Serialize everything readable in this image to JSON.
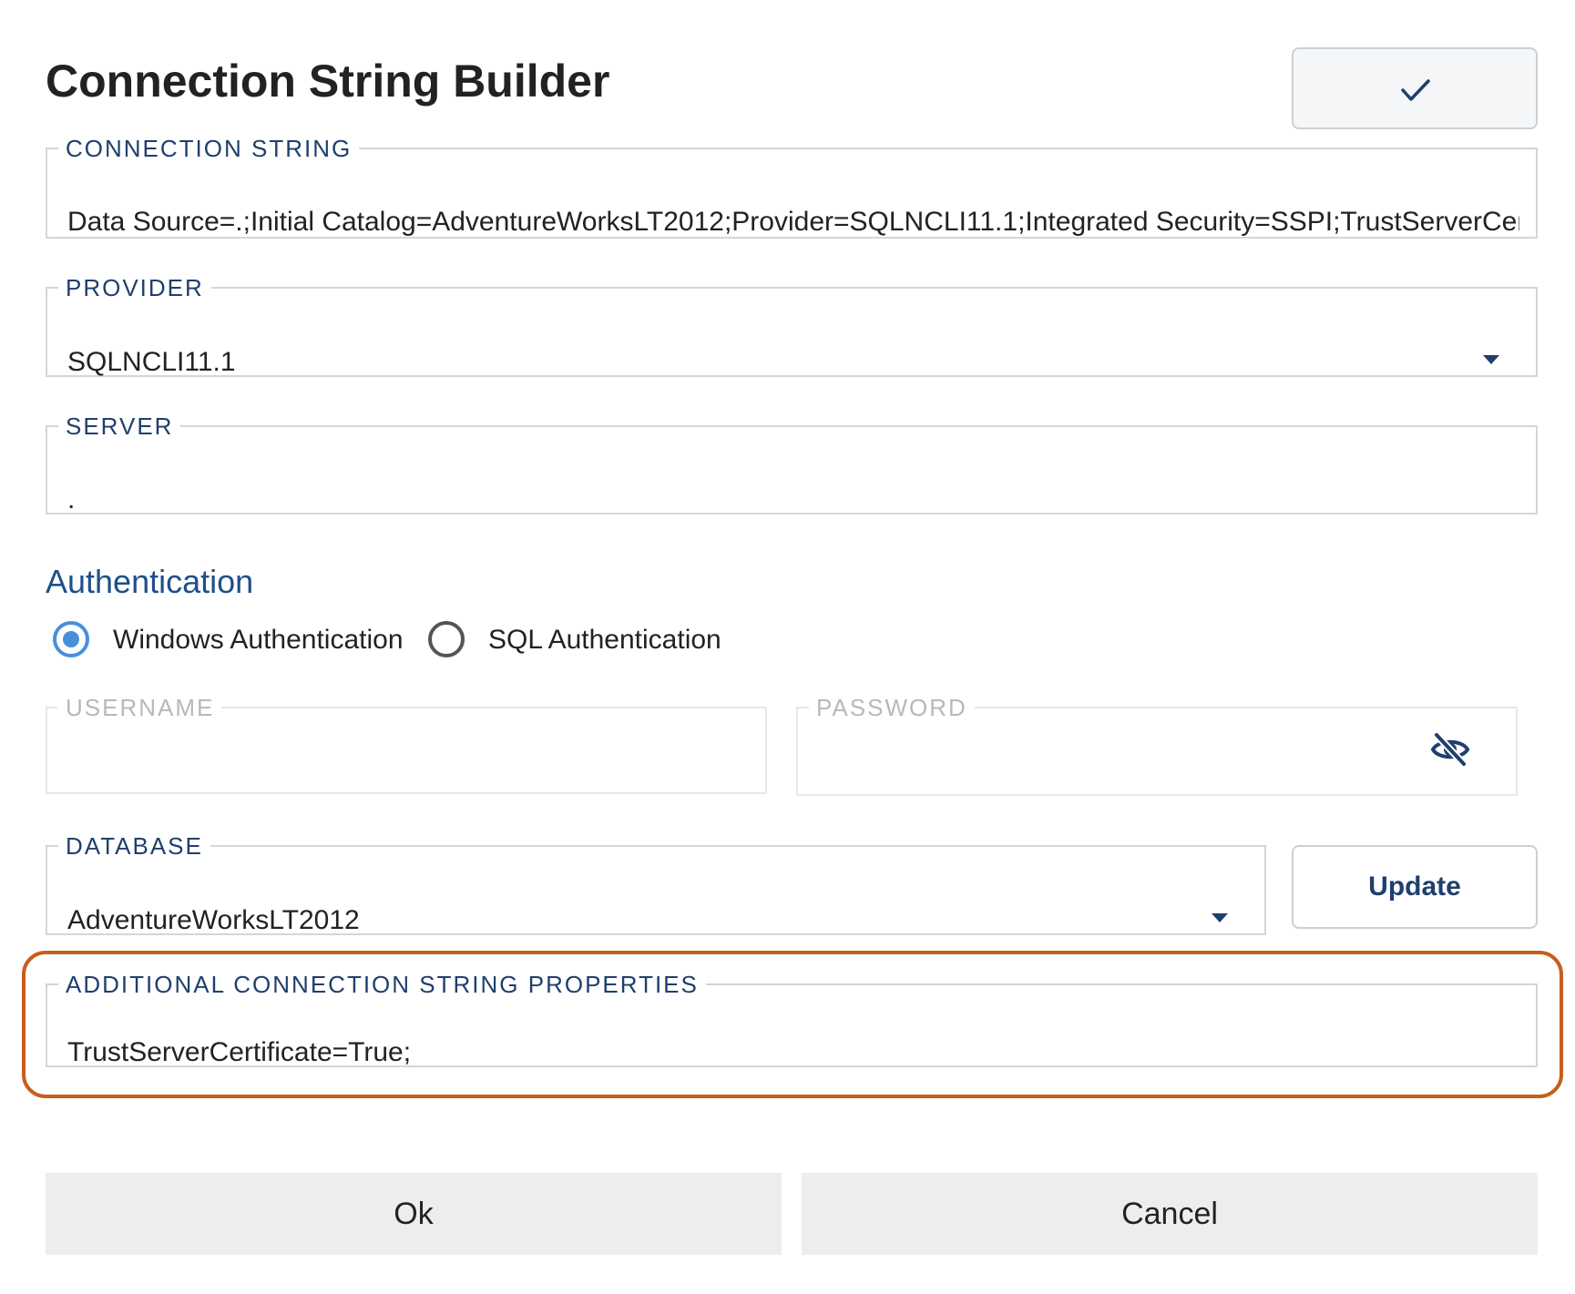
{
  "dialog": {
    "title": "Connection String Builder",
    "confirm_icon": "check-icon"
  },
  "connection_string": {
    "label": "CONNECTION STRING",
    "value": "Data Source=.;Initial Catalog=AdventureWorksLT2012;Provider=SQLNCLI11.1;Integrated Security=SSPI;TrustServerCertifi"
  },
  "provider": {
    "label": "PROVIDER",
    "value": "SQLNCLI11.1"
  },
  "server": {
    "label": "SERVER",
    "value": "."
  },
  "authentication": {
    "heading": "Authentication",
    "options": [
      {
        "label": "Windows Authentication",
        "selected": true
      },
      {
        "label": "SQL Authentication",
        "selected": false
      }
    ],
    "username_label": "USERNAME",
    "password_label": "PASSWORD",
    "password_icon": "eye-slash-icon"
  },
  "database": {
    "label": "DATABASE",
    "value": "AdventureWorksLT2012",
    "update_label": "Update"
  },
  "additional": {
    "label": "ADDITIONAL CONNECTION STRING PROPERTIES",
    "value": "TrustServerCertificate=True;"
  },
  "footer": {
    "ok_label": "Ok",
    "cancel_label": "Cancel"
  },
  "colors": {
    "accent": "#1f3f6e",
    "radio_selected": "#4a8fd9",
    "highlight": "#c65f1a",
    "button_bg": "#ededed"
  }
}
